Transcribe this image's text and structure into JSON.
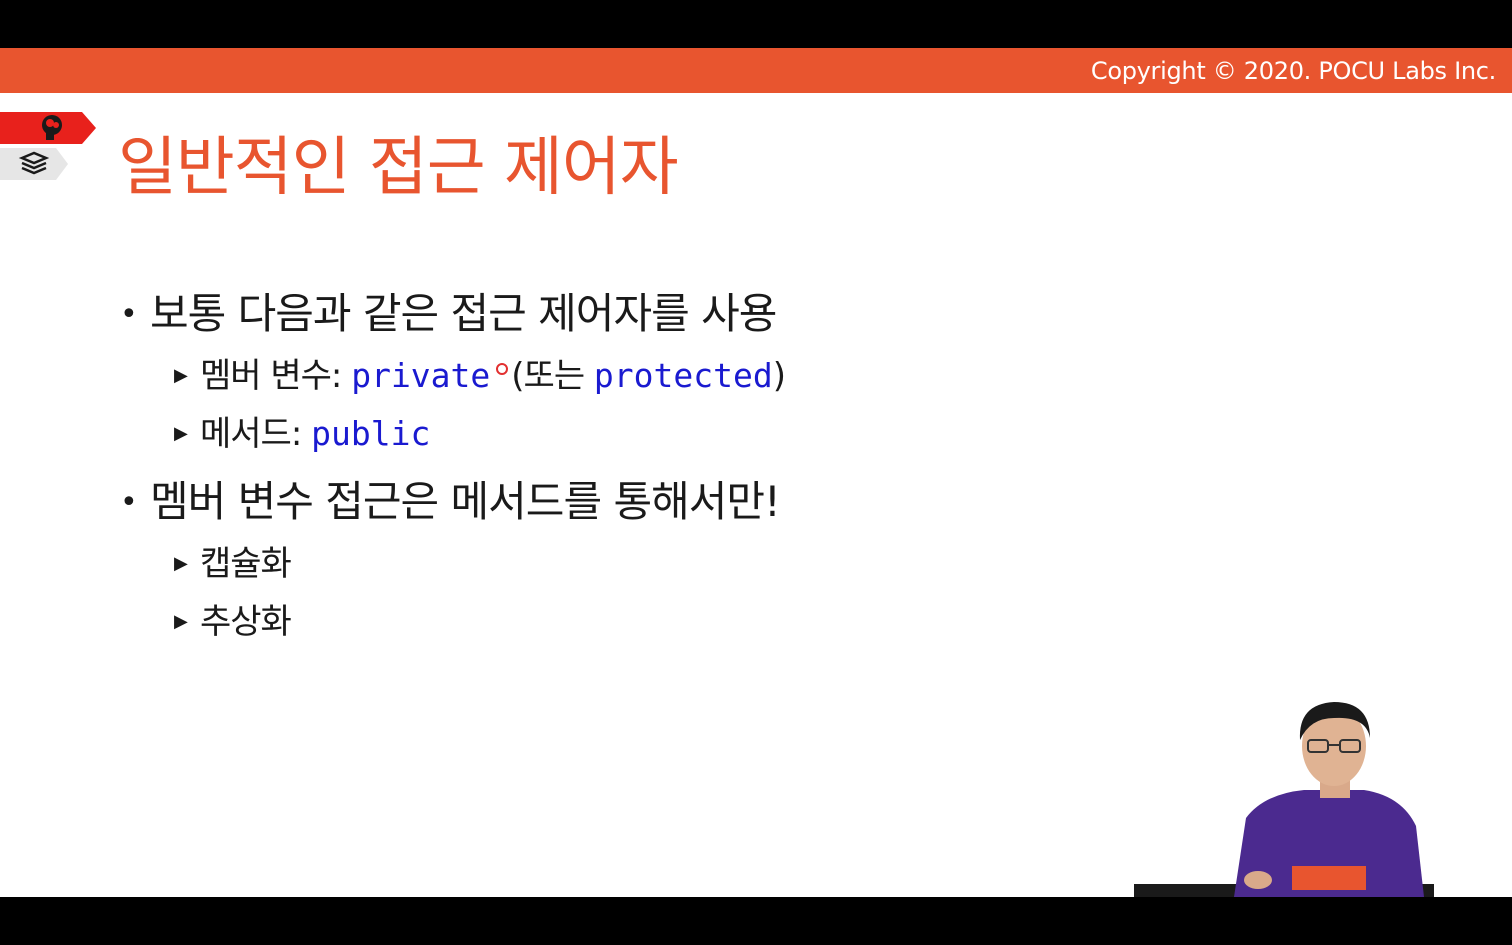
{
  "header": {
    "copyright": "Copyright © 2020. POCU Labs Inc."
  },
  "side_tabs": [
    {
      "icon": "brain-head-icon",
      "color": "#e8211c"
    },
    {
      "icon": "book-stack-icon",
      "color": "#e6e6e6"
    }
  ],
  "slide": {
    "title": "일반적인 접근 제어자",
    "bullets": [
      {
        "text": "보통 다음과 같은 접근 제어자를 사용",
        "sub": [
          {
            "prefix": "멤버 변수: ",
            "code1": "private",
            "mid": "(또는 ",
            "code2": "protected",
            "suffix": ")"
          },
          {
            "prefix": "메서드: ",
            "code1": "public"
          }
        ]
      },
      {
        "text": "멤버 변수 접근은 메서드를 통해서만!",
        "sub": [
          {
            "prefix": "캡슐화"
          },
          {
            "prefix": "추상화"
          }
        ]
      }
    ]
  },
  "colors": {
    "accent": "#e8552f",
    "code": "#1a1ad0",
    "text": "#1a1a1a"
  }
}
